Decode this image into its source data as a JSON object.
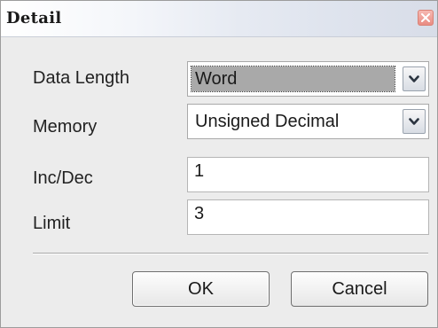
{
  "window": {
    "title": "Detail"
  },
  "form": {
    "data_length": {
      "label": "Data Length",
      "value": "Word"
    },
    "memory": {
      "label": "Memory",
      "value": "Unsigned Decimal"
    },
    "inc_dec": {
      "label": "Inc/Dec",
      "value": "1"
    },
    "limit": {
      "label": "Limit",
      "value": "3"
    }
  },
  "buttons": {
    "ok": "OK",
    "cancel": "Cancel"
  },
  "icons": {
    "close": "close-icon",
    "dropdown": "chevron-down-icon"
  },
  "colors": {
    "close_button": "#e98c82",
    "selection_highlight": "#a9a9a9"
  }
}
